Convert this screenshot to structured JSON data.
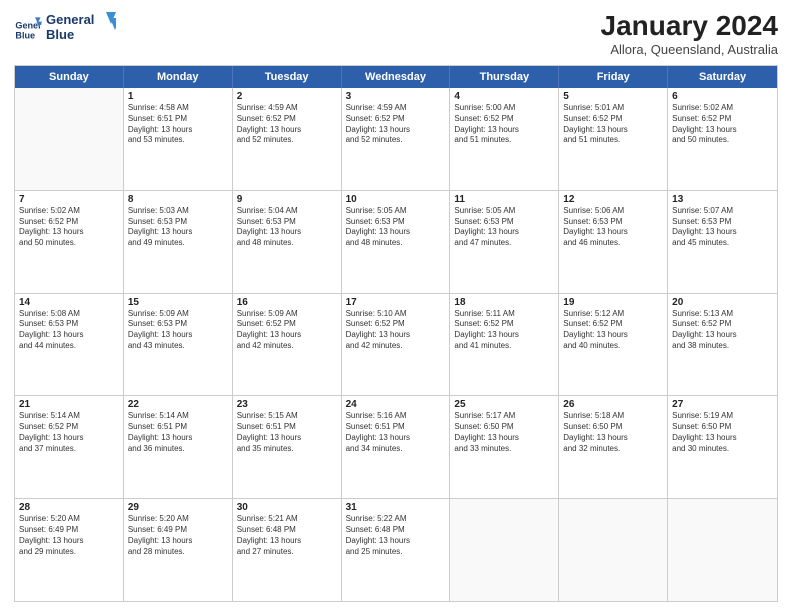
{
  "header": {
    "logo_line1": "General",
    "logo_line2": "Blue",
    "month": "January 2024",
    "location": "Allora, Queensland, Australia"
  },
  "weekdays": [
    "Sunday",
    "Monday",
    "Tuesday",
    "Wednesday",
    "Thursday",
    "Friday",
    "Saturday"
  ],
  "rows": [
    [
      {
        "day": "",
        "text": ""
      },
      {
        "day": "1",
        "text": "Sunrise: 4:58 AM\nSunset: 6:51 PM\nDaylight: 13 hours\nand 53 minutes."
      },
      {
        "day": "2",
        "text": "Sunrise: 4:59 AM\nSunset: 6:52 PM\nDaylight: 13 hours\nand 52 minutes."
      },
      {
        "day": "3",
        "text": "Sunrise: 4:59 AM\nSunset: 6:52 PM\nDaylight: 13 hours\nand 52 minutes."
      },
      {
        "day": "4",
        "text": "Sunrise: 5:00 AM\nSunset: 6:52 PM\nDaylight: 13 hours\nand 51 minutes."
      },
      {
        "day": "5",
        "text": "Sunrise: 5:01 AM\nSunset: 6:52 PM\nDaylight: 13 hours\nand 51 minutes."
      },
      {
        "day": "6",
        "text": "Sunrise: 5:02 AM\nSunset: 6:52 PM\nDaylight: 13 hours\nand 50 minutes."
      }
    ],
    [
      {
        "day": "7",
        "text": "Sunrise: 5:02 AM\nSunset: 6:52 PM\nDaylight: 13 hours\nand 50 minutes."
      },
      {
        "day": "8",
        "text": "Sunrise: 5:03 AM\nSunset: 6:53 PM\nDaylight: 13 hours\nand 49 minutes."
      },
      {
        "day": "9",
        "text": "Sunrise: 5:04 AM\nSunset: 6:53 PM\nDaylight: 13 hours\nand 48 minutes."
      },
      {
        "day": "10",
        "text": "Sunrise: 5:05 AM\nSunset: 6:53 PM\nDaylight: 13 hours\nand 48 minutes."
      },
      {
        "day": "11",
        "text": "Sunrise: 5:05 AM\nSunset: 6:53 PM\nDaylight: 13 hours\nand 47 minutes."
      },
      {
        "day": "12",
        "text": "Sunrise: 5:06 AM\nSunset: 6:53 PM\nDaylight: 13 hours\nand 46 minutes."
      },
      {
        "day": "13",
        "text": "Sunrise: 5:07 AM\nSunset: 6:53 PM\nDaylight: 13 hours\nand 45 minutes."
      }
    ],
    [
      {
        "day": "14",
        "text": "Sunrise: 5:08 AM\nSunset: 6:53 PM\nDaylight: 13 hours\nand 44 minutes."
      },
      {
        "day": "15",
        "text": "Sunrise: 5:09 AM\nSunset: 6:53 PM\nDaylight: 13 hours\nand 43 minutes."
      },
      {
        "day": "16",
        "text": "Sunrise: 5:09 AM\nSunset: 6:52 PM\nDaylight: 13 hours\nand 42 minutes."
      },
      {
        "day": "17",
        "text": "Sunrise: 5:10 AM\nSunset: 6:52 PM\nDaylight: 13 hours\nand 42 minutes."
      },
      {
        "day": "18",
        "text": "Sunrise: 5:11 AM\nSunset: 6:52 PM\nDaylight: 13 hours\nand 41 minutes."
      },
      {
        "day": "19",
        "text": "Sunrise: 5:12 AM\nSunset: 6:52 PM\nDaylight: 13 hours\nand 40 minutes."
      },
      {
        "day": "20",
        "text": "Sunrise: 5:13 AM\nSunset: 6:52 PM\nDaylight: 13 hours\nand 38 minutes."
      }
    ],
    [
      {
        "day": "21",
        "text": "Sunrise: 5:14 AM\nSunset: 6:52 PM\nDaylight: 13 hours\nand 37 minutes."
      },
      {
        "day": "22",
        "text": "Sunrise: 5:14 AM\nSunset: 6:51 PM\nDaylight: 13 hours\nand 36 minutes."
      },
      {
        "day": "23",
        "text": "Sunrise: 5:15 AM\nSunset: 6:51 PM\nDaylight: 13 hours\nand 35 minutes."
      },
      {
        "day": "24",
        "text": "Sunrise: 5:16 AM\nSunset: 6:51 PM\nDaylight: 13 hours\nand 34 minutes."
      },
      {
        "day": "25",
        "text": "Sunrise: 5:17 AM\nSunset: 6:50 PM\nDaylight: 13 hours\nand 33 minutes."
      },
      {
        "day": "26",
        "text": "Sunrise: 5:18 AM\nSunset: 6:50 PM\nDaylight: 13 hours\nand 32 minutes."
      },
      {
        "day": "27",
        "text": "Sunrise: 5:19 AM\nSunset: 6:50 PM\nDaylight: 13 hours\nand 30 minutes."
      }
    ],
    [
      {
        "day": "28",
        "text": "Sunrise: 5:20 AM\nSunset: 6:49 PM\nDaylight: 13 hours\nand 29 minutes."
      },
      {
        "day": "29",
        "text": "Sunrise: 5:20 AM\nSunset: 6:49 PM\nDaylight: 13 hours\nand 28 minutes."
      },
      {
        "day": "30",
        "text": "Sunrise: 5:21 AM\nSunset: 6:48 PM\nDaylight: 13 hours\nand 27 minutes."
      },
      {
        "day": "31",
        "text": "Sunrise: 5:22 AM\nSunset: 6:48 PM\nDaylight: 13 hours\nand 25 minutes."
      },
      {
        "day": "",
        "text": ""
      },
      {
        "day": "",
        "text": ""
      },
      {
        "day": "",
        "text": ""
      }
    ]
  ]
}
